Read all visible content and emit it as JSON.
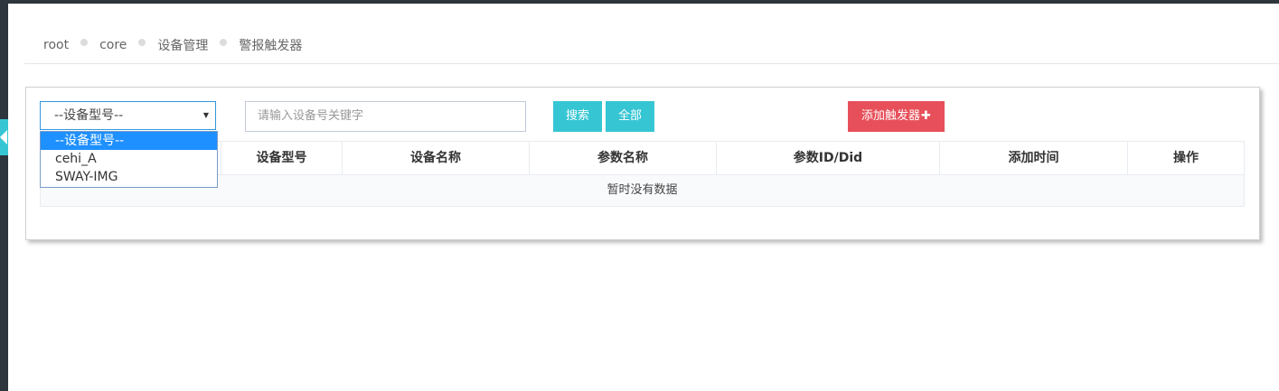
{
  "breadcrumb": [
    "root",
    "core",
    "设备管理",
    "警报触发器"
  ],
  "filter": {
    "select_value": "--设备型号--",
    "options": [
      "--设备型号--",
      "cehi_A",
      "SWAY-IMG"
    ],
    "search_placeholder": "请输入设备号关键字"
  },
  "buttons": {
    "search": "搜索",
    "all": "全部",
    "add_trigger": "添加触发器"
  },
  "table": {
    "columns": [
      "",
      "设备型号",
      "设备名称",
      "参数名称",
      "参数ID/Did",
      "添加时间",
      "操作"
    ],
    "empty_text": "暂时没有数据"
  },
  "colors": {
    "accent": "#36c6d3",
    "danger": "#e7505a",
    "select_highlight": "#1e90ff",
    "chrome": "#2f353d"
  },
  "icons": {
    "sidebar_toggle": "chevron-left-icon",
    "add": "plus-icon",
    "dropdown": "caret-down-icon"
  }
}
